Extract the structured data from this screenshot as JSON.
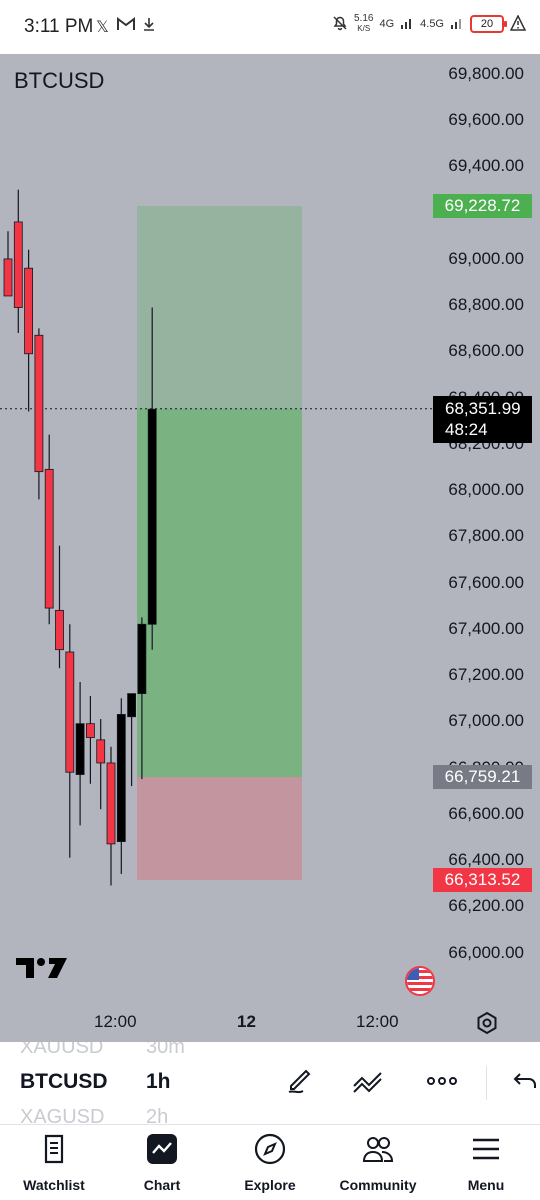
{
  "status_bar": {
    "time": "3:11 PM",
    "left_icons": [
      "x-icon",
      "gmail-icon",
      "download-icon"
    ],
    "net_speed_value": "5.16",
    "net_speed_unit": "K/S",
    "network_1": "4G",
    "network_2": "4.5G",
    "battery": "20"
  },
  "chart": {
    "symbol": "BTCUSD",
    "price_axis": [
      "69,800.00",
      "69,600.00",
      "69,400.00",
      "69,000.00",
      "68,800.00",
      "68,600.00",
      "68,400.00",
      "68,200.00",
      "68,000.00",
      "67,800.00",
      "67,600.00",
      "67,400.00",
      "67,200.00",
      "67,000.00",
      "66,800.00",
      "66,600.00",
      "66,400.00",
      "66,200.00",
      "66,000.00"
    ],
    "take_profit_price": "69,228.72",
    "current_price": "68,351.99",
    "countdown": "48:24",
    "entry_price": "66,759.21",
    "stop_loss_price": "66,313.52",
    "time_axis": [
      "12:00",
      "12",
      "12:00"
    ],
    "colors": {
      "up": "#000000",
      "down": "#f23645",
      "background": "#b2b5be",
      "profit_zone": "#4caf50",
      "loss_zone": "#f23645"
    }
  },
  "chart_data": {
    "type": "candlestick",
    "symbol": "BTCUSD",
    "interval": "1h",
    "ylim": [
      65900,
      69900
    ],
    "candles": [
      {
        "o": 69000,
        "h": 69120,
        "l": 68870,
        "c": 68840
      },
      {
        "o": 69160,
        "h": 69300,
        "l": 68680,
        "c": 68790
      },
      {
        "o": 68960,
        "h": 69040,
        "l": 68340,
        "c": 68590
      },
      {
        "o": 68670,
        "h": 68700,
        "l": 67960,
        "c": 68080
      },
      {
        "o": 68090,
        "h": 68240,
        "l": 67420,
        "c": 67490
      },
      {
        "o": 67480,
        "h": 67760,
        "l": 67230,
        "c": 67310
      },
      {
        "o": 67300,
        "h": 67420,
        "l": 66410,
        "c": 66780
      },
      {
        "o": 66770,
        "h": 67170,
        "l": 66550,
        "c": 66990
      },
      {
        "o": 66990,
        "h": 67110,
        "l": 66730,
        "c": 66930
      },
      {
        "o": 66920,
        "h": 67010,
        "l": 66620,
        "c": 66820
      },
      {
        "o": 66820,
        "h": 66890,
        "l": 66290,
        "c": 66470
      },
      {
        "o": 66480,
        "h": 67100,
        "l": 66340,
        "c": 67030
      },
      {
        "o": 67020,
        "h": 67090,
        "l": 66720,
        "c": 67120
      },
      {
        "o": 67120,
        "h": 67450,
        "l": 66750,
        "c": 67420
      },
      {
        "o": 67420,
        "h": 68790,
        "l": 67310,
        "c": 68350
      }
    ],
    "position": {
      "take_profit": 69228.72,
      "entry": 66759.21,
      "stop_loss": 66313.52
    },
    "current_price": 68351.99,
    "y_ticks": [
      69800,
      69600,
      69400,
      69200,
      69000,
      68800,
      68600,
      68400,
      68200,
      68000,
      67800,
      67600,
      67400,
      67200,
      67000,
      66800,
      66600,
      66400,
      66200,
      66000
    ],
    "x_ticks": [
      "12:00",
      "12",
      "12:00"
    ]
  },
  "toolbar": {
    "ghost_prev_symbol": "XAUUSD",
    "ghost_prev_interval": "30m",
    "symbol": "BTCUSD",
    "interval": "1h",
    "ghost_next_symbol": "XAGUSD",
    "ghost_next_interval": "2h"
  },
  "bottom_nav": {
    "items": [
      {
        "label": "Watchlist",
        "icon": "watchlist-icon"
      },
      {
        "label": "Chart",
        "icon": "chart-icon"
      },
      {
        "label": "Explore",
        "icon": "compass-icon"
      },
      {
        "label": "Community",
        "icon": "community-icon"
      },
      {
        "label": "Menu",
        "icon": "menu-icon"
      }
    ]
  }
}
